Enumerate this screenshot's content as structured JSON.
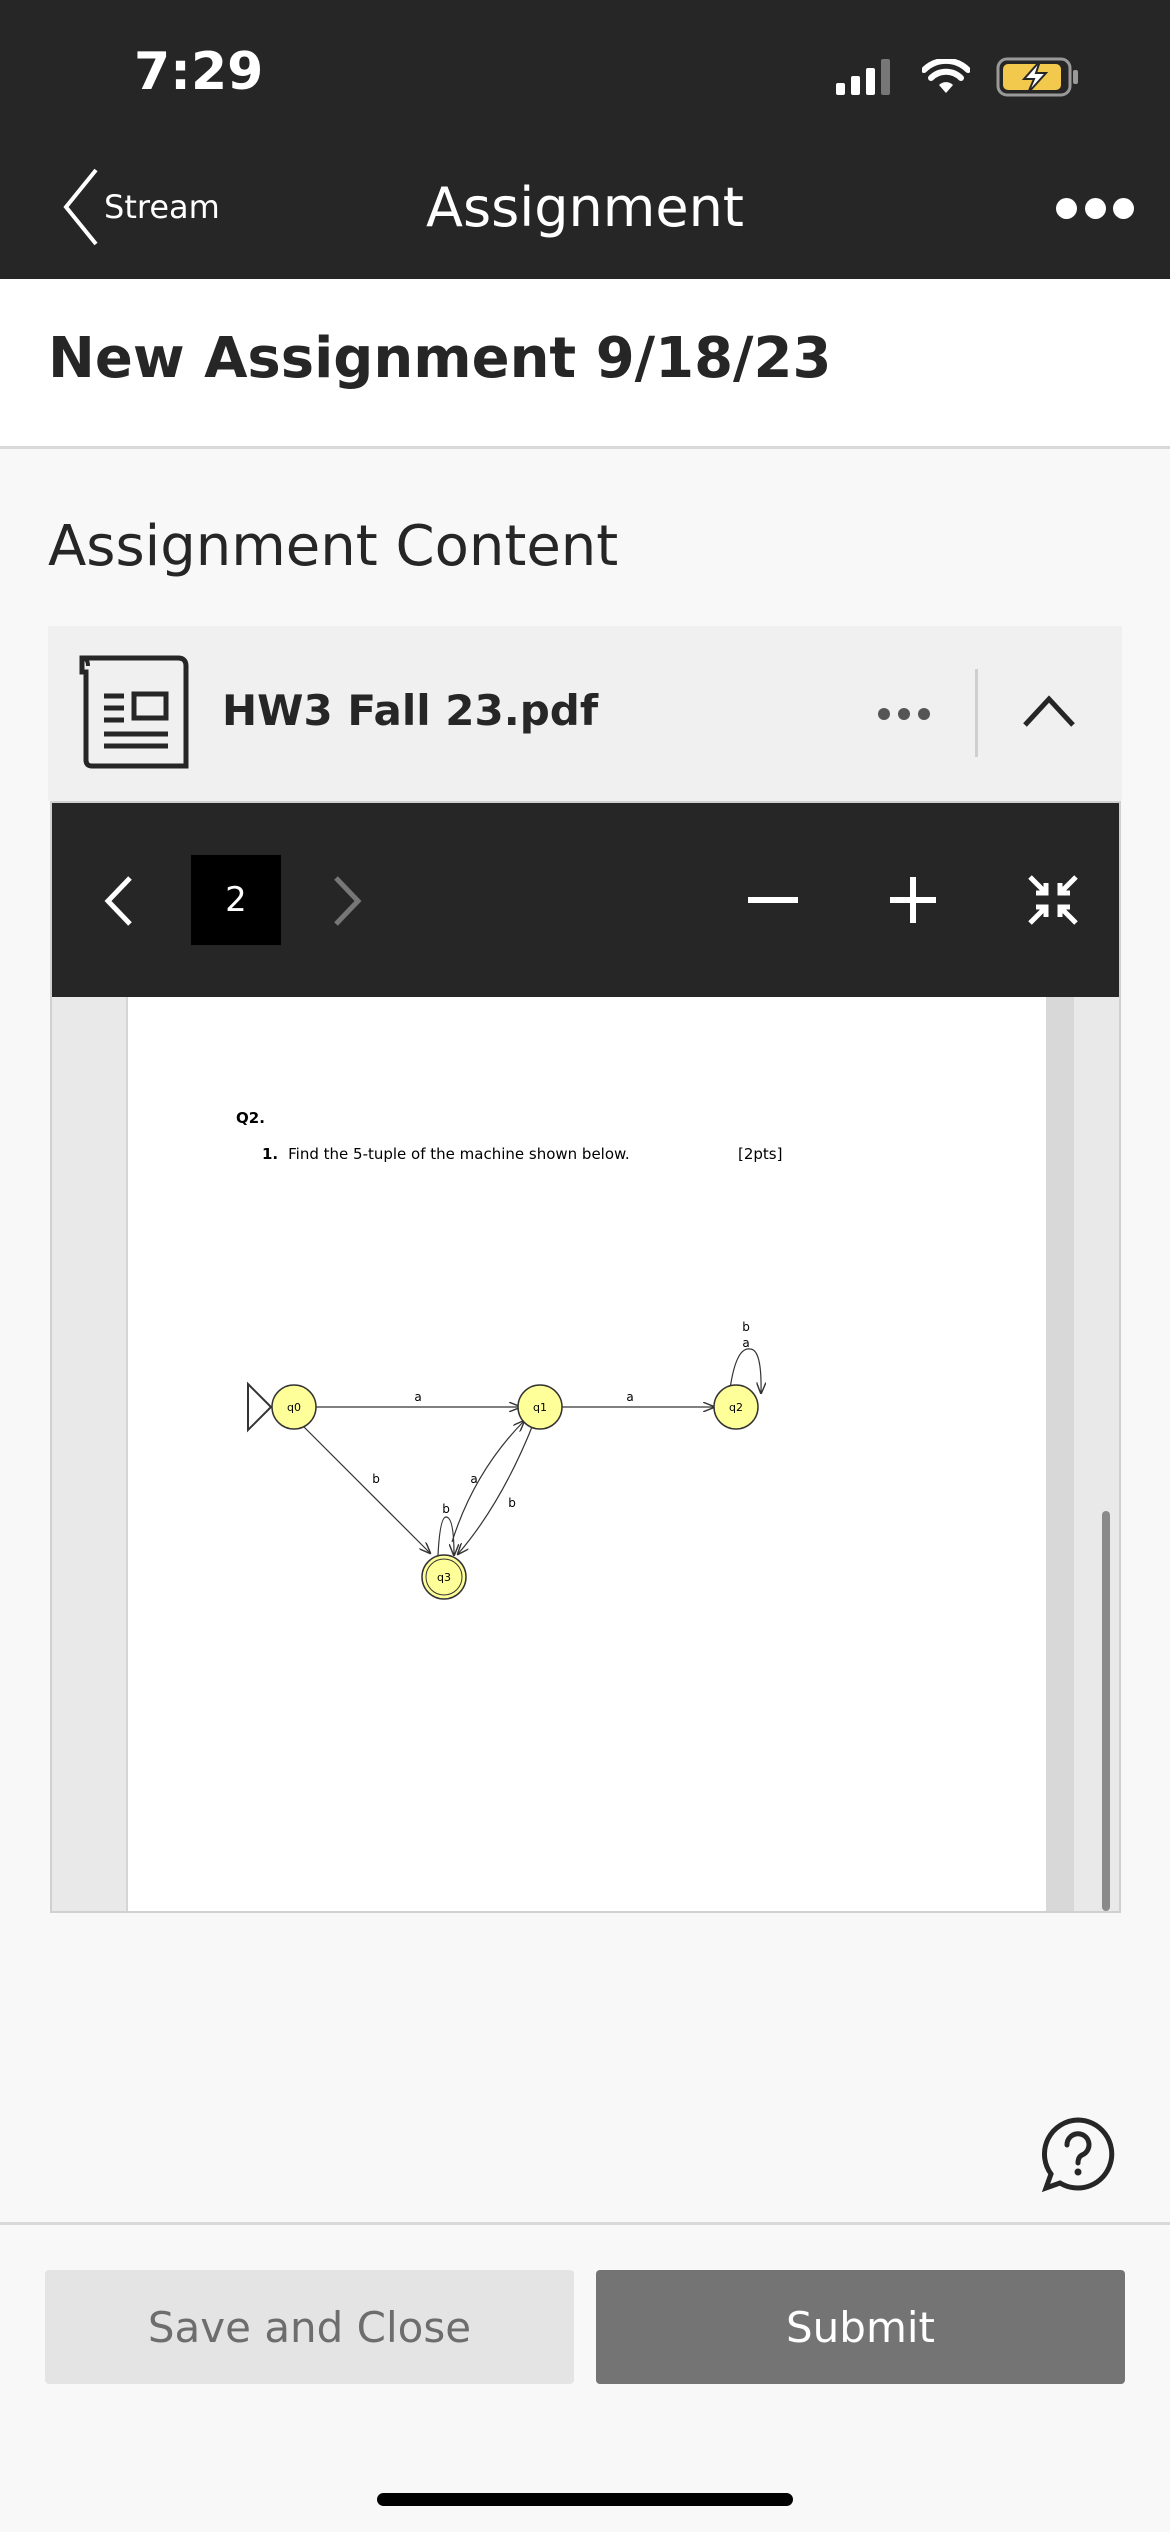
{
  "status_bar": {
    "time": "7:29",
    "icons": [
      "signal-icon",
      "wifi-icon",
      "battery-charging-icon"
    ],
    "battery_color": "#f2c94c"
  },
  "nav": {
    "back_label": "Stream",
    "title": "Assignment",
    "more_icon": "more-dots-icon"
  },
  "assignment": {
    "title": "New Assignment 9/18/23"
  },
  "content": {
    "heading": "Assignment Content",
    "file": {
      "name": "HW3 Fall 23.pdf",
      "icon": "document-icon"
    }
  },
  "viewer": {
    "current_page": "2",
    "tools": [
      "prev-page-icon",
      "next-page-icon",
      "zoom-out-icon",
      "zoom-in-icon",
      "collapse-icon"
    ],
    "page_content": {
      "question_label": "Q2.",
      "item_number": "1.",
      "item_text": "Find the 5-tuple of the machine shown below.",
      "points": "[2pts]",
      "diagram": {
        "states": [
          "q0",
          "q1",
          "q2",
          "q3"
        ],
        "edge_labels": {
          "q0_q1": "a",
          "q1_q2": "a",
          "q2_loop_top": "b",
          "q2_loop_bottom": "a",
          "q0_q3": "b",
          "q3_q1": "a",
          "q1_q3": "b",
          "q3_loop": "b"
        },
        "state_fill": "#ffff99"
      }
    }
  },
  "footer": {
    "save_label": "Save and Close",
    "submit_label": "Submit",
    "help_icon": "help-icon"
  }
}
